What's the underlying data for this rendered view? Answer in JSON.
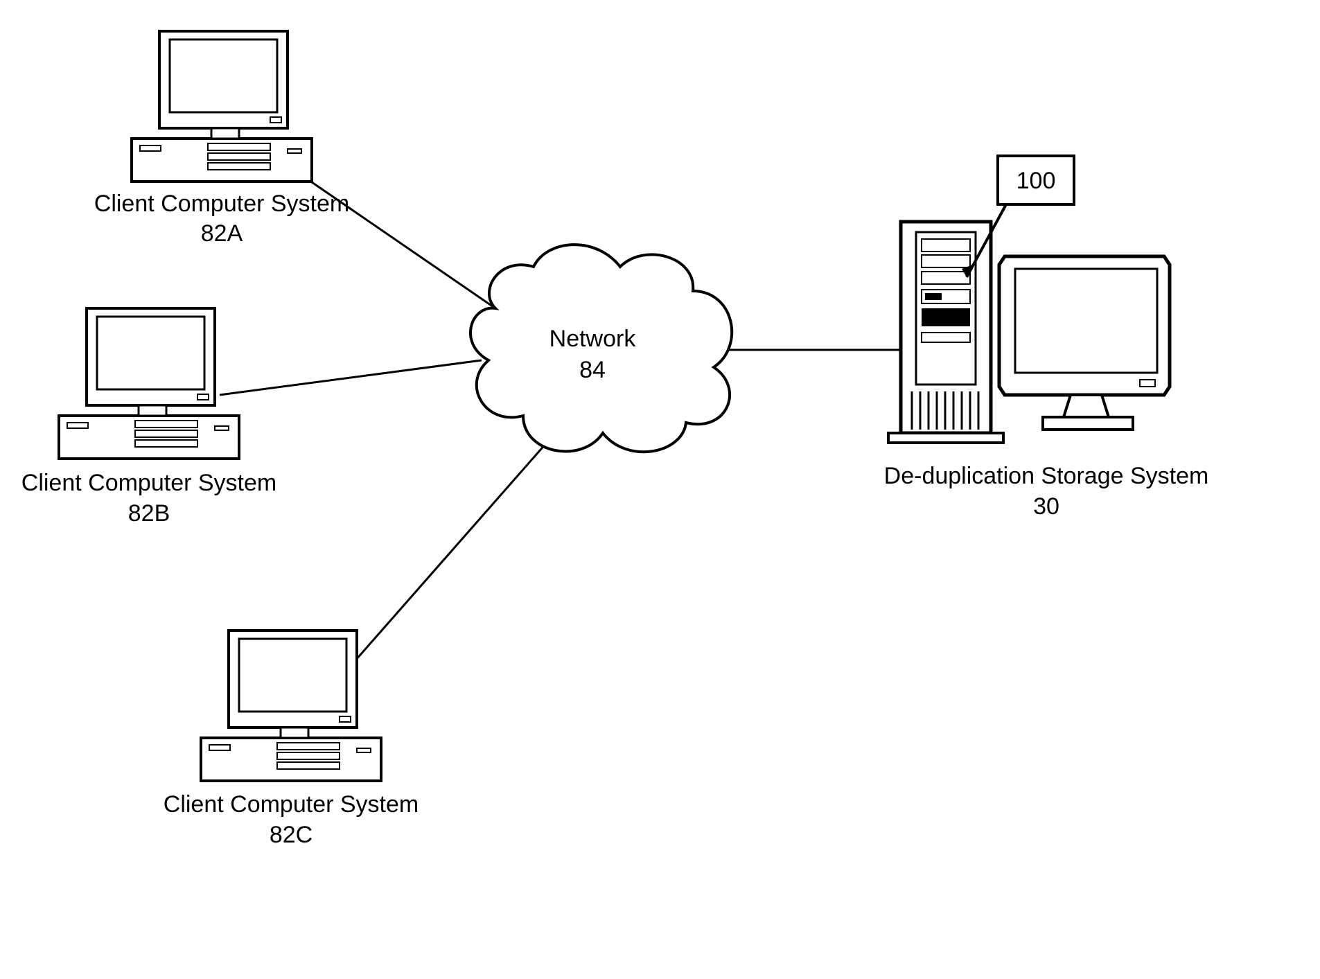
{
  "clients": [
    {
      "label_line1": "Client Computer System",
      "label_line2": "82A"
    },
    {
      "label_line1": "Client Computer System",
      "label_line2": "82B"
    },
    {
      "label_line1": "Client Computer System",
      "label_line2": "82C"
    }
  ],
  "network": {
    "label_line1": "Network",
    "label_line2": "84"
  },
  "server": {
    "label_line1": "De-duplication Storage System",
    "label_line2": "30",
    "callout": "100"
  }
}
